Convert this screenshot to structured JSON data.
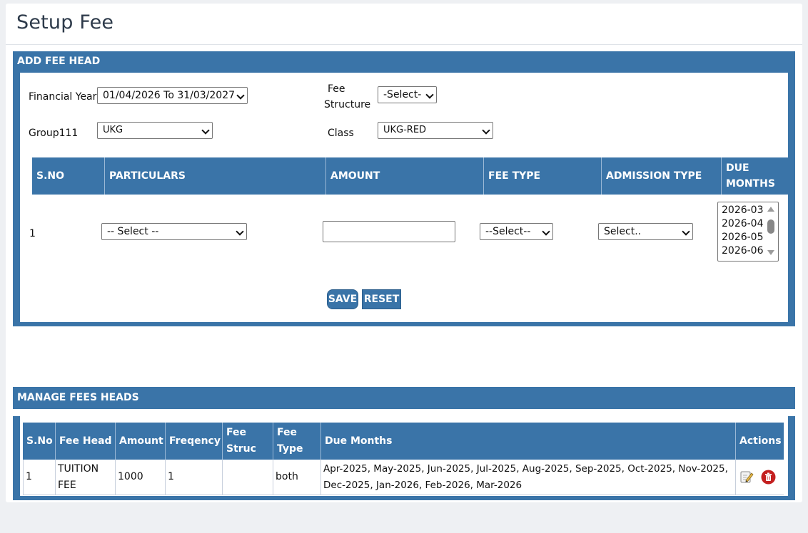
{
  "page": {
    "title": "Setup Fee"
  },
  "add_fee_head": {
    "section_title": "ADD FEE HEAD",
    "financial_year": {
      "label": "Financial Year",
      "value": "01/04/2026 To 31/03/2027"
    },
    "fee_structure": {
      "label_line1": "Fee",
      "label_line2": "Structure",
      "value": "-Select-"
    },
    "group": {
      "label": "Group111",
      "value": "UKG"
    },
    "class": {
      "label": "Class",
      "value": "UKG-RED"
    },
    "columns": {
      "sno": "S.NO",
      "particulars": "PARTICULARS",
      "amount": "AMOUNT",
      "fee_type": "FEE TYPE",
      "admission_type": "ADMISSION TYPE",
      "due_months_line1": "DUE",
      "due_months_line2": "MONTHS"
    },
    "row": {
      "sno": "1",
      "particulars": "-- Select --",
      "amount": "",
      "fee_type": "--Select--",
      "admission_type": "Select..",
      "due_months_options": [
        "2026-03",
        "2026-04",
        "2026-05",
        "2026-06"
      ]
    },
    "buttons": {
      "save": "SAVE",
      "reset": "RESET"
    }
  },
  "manage": {
    "section_title": "MANAGE FEES HEADS",
    "columns": {
      "sno": "S.No",
      "fee_head": "Fee Head",
      "amount": "Amount",
      "freqency": "Freqency",
      "fee_struc_line1": "Fee",
      "fee_struc_line2": "Struc",
      "fee_type_line1": "Fee",
      "fee_type_line2": "Type",
      "due_months": "Due Months",
      "actions": "Actions"
    },
    "rows": [
      {
        "sno": "1",
        "fee_head_line1": "TUITION",
        "fee_head_line2": "FEE",
        "amount": "1000",
        "freqency": "1",
        "fee_struc": "",
        "fee_type": "both",
        "due_months_line1": "Apr-2025, May-2025, Jun-2025, Jul-2025, Aug-2025, Sep-2025, Oct-2025, Nov-2025,",
        "due_months_line2": "Dec-2025, Jan-2026, Feb-2026, Mar-2026",
        "action_icons": [
          "edit-icon",
          "delete-icon"
        ]
      }
    ]
  },
  "colors": {
    "header_blue": "#3a74a8",
    "delete_red": "#c42020"
  }
}
